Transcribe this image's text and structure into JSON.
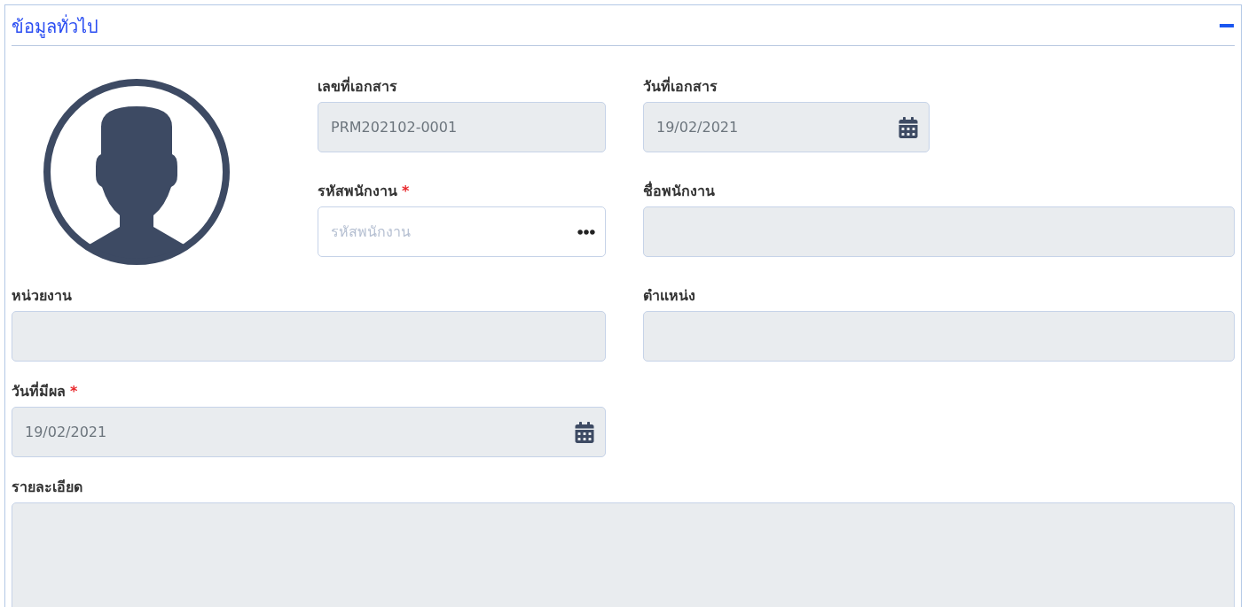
{
  "panel": {
    "title": "ข้อมูลทั่วไป",
    "expanded": true
  },
  "avatar": {
    "kind": "placeholder"
  },
  "fields": [
    {
      "label": "เลขที่เอกสาร",
      "kind": "text",
      "value": "PRM202102-0001",
      "disabled": true
    },
    {
      "label": "วันที่เอกสาร",
      "kind": "date",
      "value": "19/02/2021",
      "disabled": true
    },
    {
      "label": "รหัสพนักงาน",
      "required_mark": "*",
      "kind": "lookup",
      "placeholder": "รหัสพนักงาน",
      "disabled": false
    },
    {
      "label": "ชื่อพนักงาน",
      "kind": "text",
      "disabled": true
    },
    {
      "label": "หน่วยงาน",
      "kind": "text",
      "disabled": true
    },
    {
      "label": "ตำแหน่ง",
      "kind": "text",
      "disabled": true
    },
    {
      "label": "วันที่มีผล",
      "required_mark": "*",
      "kind": "date",
      "value": "19/02/2021",
      "disabled": true
    },
    {
      "label": "รายละเอียด",
      "kind": "textarea",
      "disabled": true
    }
  ]
}
